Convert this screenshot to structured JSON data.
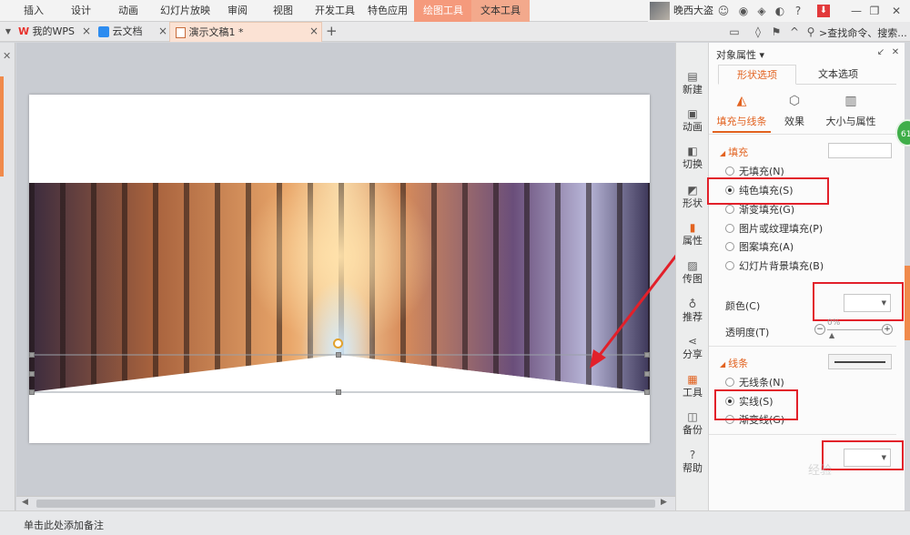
{
  "ribbon": {
    "tabs": [
      "插入",
      "设计",
      "动画",
      "幻灯片放映",
      "审阅",
      "视图",
      "开发工具",
      "特色应用"
    ],
    "context_tabs": [
      "绘图工具",
      "文本工具"
    ],
    "user_name": "晚西大盗"
  },
  "doc_tabs": {
    "items": [
      "我的WPS",
      "云文档",
      "演示文稿1 *"
    ],
    "add_label": "+",
    "search_placeholder": ">查找命令、搜索..."
  },
  "vertical_toolbar": {
    "items": [
      {
        "label": "新建",
        "icon": "new-doc-icon"
      },
      {
        "label": "动画",
        "icon": "animation-icon"
      },
      {
        "label": "切换",
        "icon": "transition-icon"
      },
      {
        "label": "形状",
        "icon": "shape-icon"
      },
      {
        "label": "属性",
        "icon": "property-icon"
      },
      {
        "label": "传图",
        "icon": "upload-image-icon"
      },
      {
        "label": "推荐",
        "icon": "recommend-icon"
      },
      {
        "label": "分享",
        "icon": "share-icon"
      },
      {
        "label": "工具",
        "icon": "toolbox-icon"
      },
      {
        "label": "备份",
        "icon": "backup-icon"
      },
      {
        "label": "帮助",
        "icon": "help-icon"
      }
    ]
  },
  "pane": {
    "title": "对象属性",
    "tabs": [
      "形状选项",
      "文本选项"
    ],
    "subtabs": [
      {
        "label": "填充与线条",
        "icon": "paint-bucket-icon"
      },
      {
        "label": "效果",
        "icon": "cube-icon"
      },
      {
        "label": "大小与属性",
        "icon": "size-icon"
      }
    ],
    "fill": {
      "header": "填充",
      "options": [
        "无填充(N)",
        "纯色填充(S)",
        "渐变填充(G)",
        "图片或纹理填充(P)",
        "图案填充(A)",
        "幻灯片背景填充(B)"
      ],
      "selected": "纯色填充(S)",
      "color_label": "颜色(C)",
      "transparency_label": "透明度(T)",
      "transparency_value": "0%"
    },
    "line": {
      "header": "线条",
      "options": [
        "无线条(N)",
        "实线(S)",
        "渐变线(G)"
      ],
      "selected": "实线(S)"
    }
  },
  "status": {
    "notes_placeholder": "单击此处添加备注"
  },
  "badge_text": "61",
  "watermark": "经验"
}
